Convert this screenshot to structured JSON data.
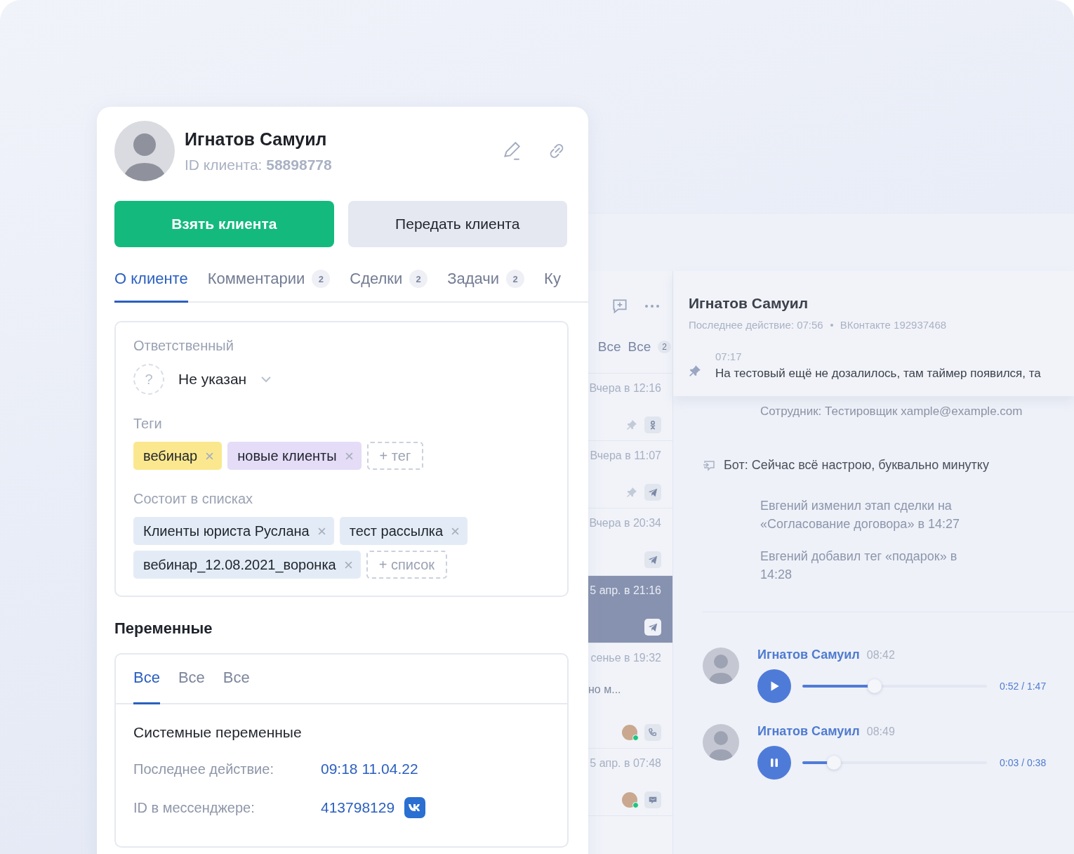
{
  "client_card": {
    "name": "Игнатов Самуил",
    "id_label": "ID клиента:",
    "id_value": "58898778",
    "buttons": [
      {
        "label": "Взять клиента",
        "kind": "primary"
      },
      {
        "label": "Передать клиента",
        "kind": "secondary"
      }
    ],
    "tabs": [
      {
        "label": "О клиенте",
        "selected": true
      },
      {
        "label": "Комментарии",
        "badge": "2",
        "selected": false
      },
      {
        "label": "Сделки",
        "badge": "2",
        "selected": false
      },
      {
        "label": "Задачи",
        "badge": "2",
        "selected": false
      },
      {
        "label": "Ку",
        "selected": false
      }
    ],
    "responsible": {
      "label": "Ответственный",
      "mark": "?",
      "value": "Не указан"
    },
    "tags": {
      "label": "Теги",
      "items": [
        {
          "text": "вебинар",
          "color": "#fbe88e"
        },
        {
          "text": "новые клиенты",
          "color": "#e5dcf8"
        }
      ],
      "add": "+ тег"
    },
    "lists": {
      "label": "Состоит в списках",
      "items": [
        "Клиенты юриста Руслана",
        "тест рассылка",
        "вебинар_12.08.2021_воронка"
      ],
      "add": "+ список"
    },
    "variables": {
      "title": "Переменные",
      "tabs": [
        {
          "label": "Все",
          "selected": true
        },
        {
          "label": "Все",
          "selected": false
        },
        {
          "label": "Все",
          "selected": false
        }
      ],
      "section": "Системные переменные",
      "rows": [
        {
          "label": "Последнее действие:",
          "value": "09:18 11.04.22"
        },
        {
          "label": "ID в мессенджере:",
          "value": "413798129",
          "kind": "messenger"
        }
      ]
    }
  },
  "conversations": {
    "tabs": [
      "Все",
      "Все"
    ],
    "tab_badge": "2",
    "items": [
      {
        "time": "Вчера в 12:16",
        "pinned": true,
        "avatar": false,
        "kind": "ok",
        "selected": false
      },
      {
        "time": "Вчера в 11:07",
        "pinned": true,
        "avatar": false,
        "kind": "telegram",
        "selected": false
      },
      {
        "time": "Вчера в 20:34",
        "pinned": false,
        "avatar": false,
        "kind": "telegram",
        "selected": false
      },
      {
        "time": "5 апр. в 21:16",
        "pinned": false,
        "avatar": false,
        "kind": "telegram",
        "selected": true
      },
      {
        "time": "сенье в 19:32",
        "preview": "но м...",
        "pinned": false,
        "avatar": true,
        "kind": "phone",
        "selected": false
      },
      {
        "time": "5 апр. в 07:48",
        "pinned": false,
        "avatar": true,
        "kind": "chat",
        "selected": false
      }
    ]
  },
  "chat": {
    "name": "Игнатов Самуил",
    "last_action": "Последнее действие: 07:56",
    "channel": "ВКонтакте 192937468",
    "pinned": {
      "time": "07:17",
      "text": "На тестовый ещё не дозалилось, там таймер появился, та"
    },
    "messages": [
      {
        "kind": "system",
        "text": "Сотрудник: Тестировщик xample@example.com"
      },
      {
        "kind": "bot",
        "text": "Бот: Сейчас всё настрою, буквально минутку"
      },
      {
        "kind": "event",
        "text": "Евгений изменил этап сделки на «Согласование договора» в 14:27"
      },
      {
        "kind": "event",
        "text": "Евгений добавил тег «подарок» в 14:28"
      },
      {
        "kind": "divider"
      },
      {
        "kind": "voice",
        "author": "Игнатов Самуил",
        "time": "08:42",
        "playing": false,
        "level": 0.39,
        "reading": "0:52 / 1:47"
      },
      {
        "kind": "voice",
        "author": "Игнатов Самуил",
        "time": "08:49",
        "playing": true,
        "level": 0.17,
        "reading": "0:03 / 0:38"
      }
    ]
  }
}
